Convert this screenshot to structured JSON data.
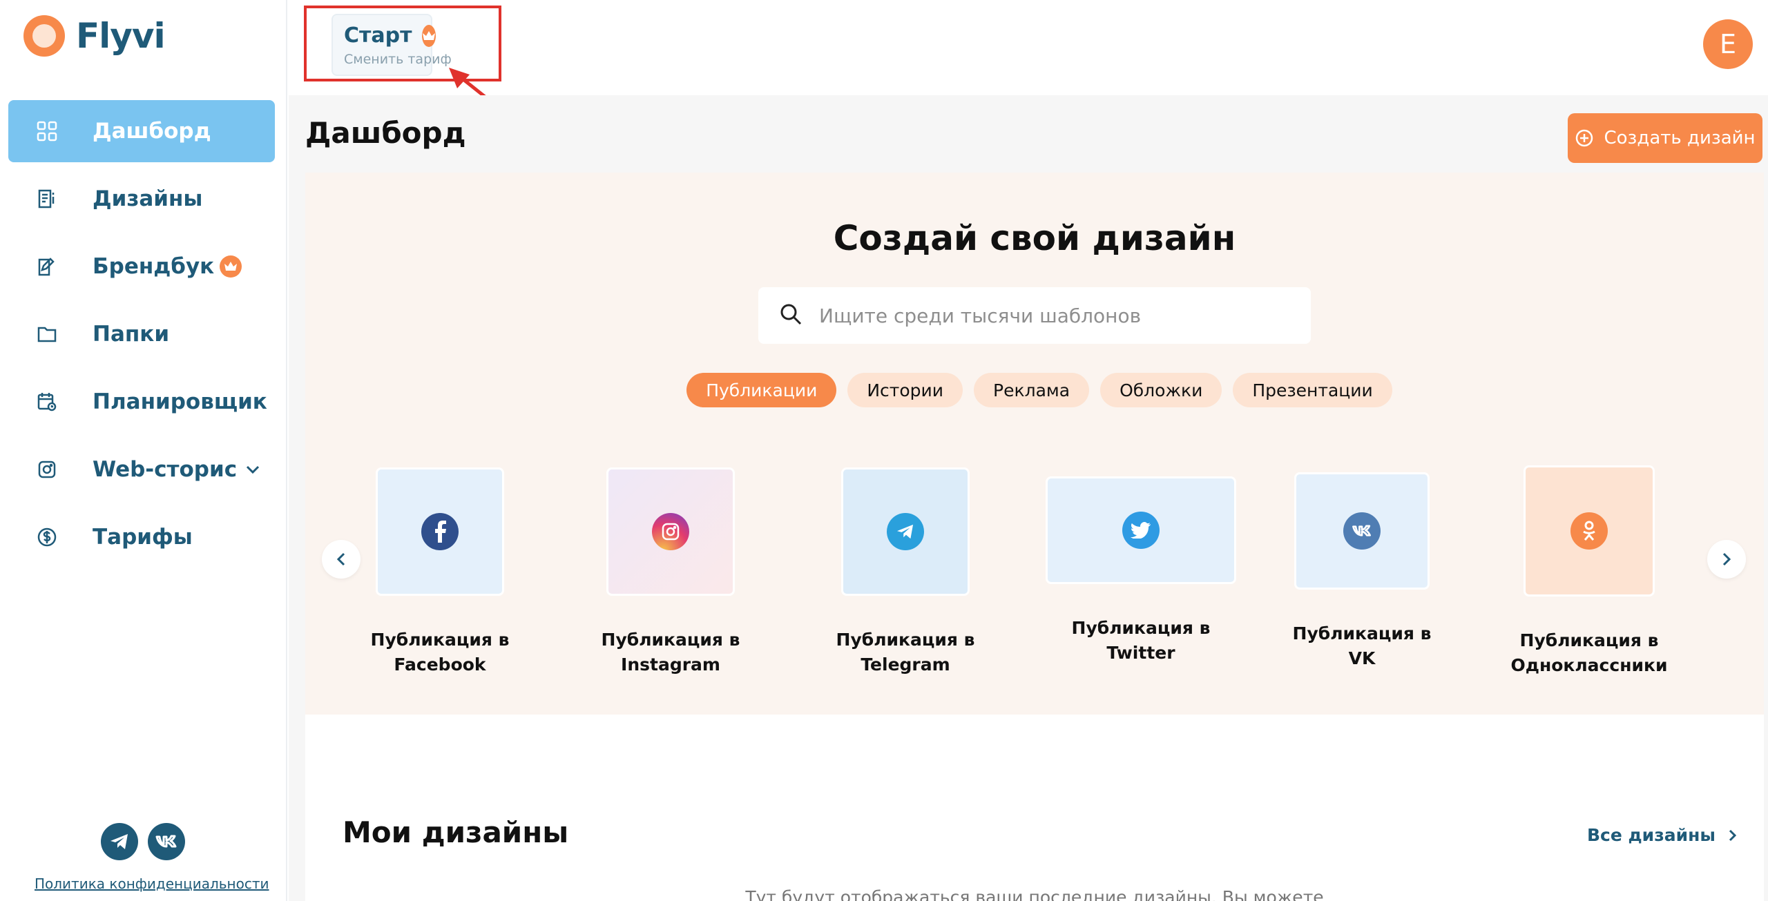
{
  "brand": {
    "name": "Flyvi"
  },
  "sidebar": {
    "items": [
      {
        "label": "Дашборд",
        "icon": "grid-icon",
        "active": true
      },
      {
        "label": "Дизайны",
        "icon": "document-icon"
      },
      {
        "label": "Брендбук",
        "icon": "edit-icon",
        "badge": "crown-icon"
      },
      {
        "label": "Папки",
        "icon": "folder-icon"
      },
      {
        "label": "Планировщик",
        "icon": "calendar-icon"
      },
      {
        "label": "Web-сторис",
        "icon": "instagram-icon",
        "expand": "chevron-down-icon"
      },
      {
        "label": "Тарифы",
        "icon": "dollar-icon"
      }
    ],
    "social": [
      "telegram-icon",
      "vk-icon"
    ],
    "privacy_label": "Политика конфиденциальности"
  },
  "topbar": {
    "plan_name": "Старт",
    "plan_action": "Сменить тариф",
    "avatar_letter": "E"
  },
  "page": {
    "title": "Дашборд",
    "create_label": "Создать дизайн"
  },
  "hero": {
    "title": "Создай свой дизайн",
    "search_placeholder": "Ищите среди тысячи шаблонов",
    "chips": [
      "Публикации",
      "Истории",
      "Реклама",
      "Обложки",
      "Презентации"
    ],
    "active_chip": "Публикации",
    "cards": [
      {
        "label": "Публикация в Facebook",
        "icon": "facebook-icon"
      },
      {
        "label": "Публикация в Instagram",
        "icon": "instagram-icon"
      },
      {
        "label": "Публикация в Telegram",
        "icon": "telegram-icon"
      },
      {
        "label": "Публикация в Twitter",
        "icon": "twitter-icon"
      },
      {
        "label": "Публикация в VK",
        "icon": "vk-icon"
      },
      {
        "label": "Публикация в Одноклассники",
        "icon": "odnoklassniki-icon"
      }
    ]
  },
  "designs": {
    "title": "Мои дизайны",
    "all_label": "Все дизайны",
    "empty_hint": "Тут будут отображаться ваши последние дизайны. Вы можете"
  },
  "colors": {
    "accent": "#f7894a",
    "brand_text": "#1f5a78",
    "active_nav": "#7ac4f0",
    "annotation_red": "#e0322c"
  }
}
